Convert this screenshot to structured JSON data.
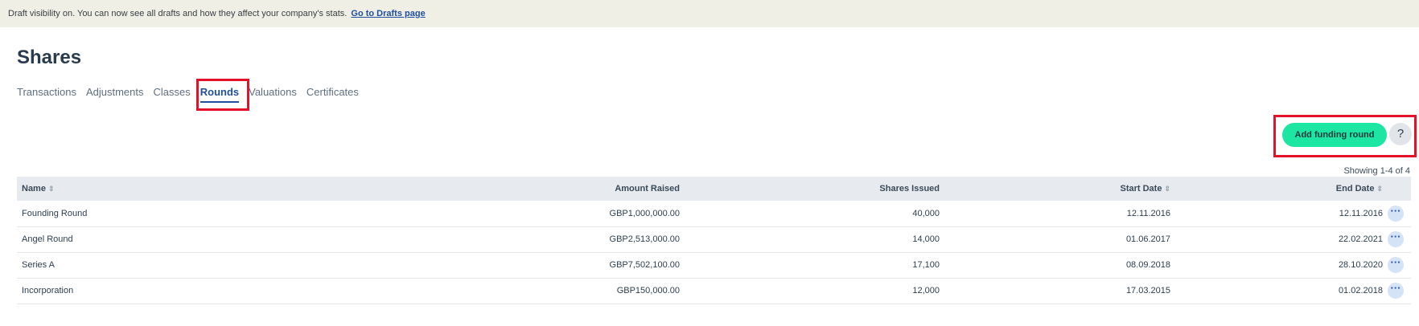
{
  "banner": {
    "text": "Draft visibility on. You can now see all drafts and how they affect your company's stats.",
    "link": "Go to Drafts page"
  },
  "page": {
    "title": "Shares"
  },
  "tabs": [
    {
      "label": "Transactions"
    },
    {
      "label": "Adjustments"
    },
    {
      "label": "Classes"
    },
    {
      "label": "Rounds",
      "active": true
    },
    {
      "label": "Valuations"
    },
    {
      "label": "Certificates"
    }
  ],
  "actions": {
    "add_label": "Add funding round",
    "help_label": "?"
  },
  "table": {
    "showing": "Showing 1-4 of 4",
    "columns": {
      "name": "Name",
      "amount": "Amount Raised",
      "shares": "Shares Issued",
      "start": "Start Date",
      "end": "End Date"
    },
    "sort_icon": "⇕",
    "more_icon": "···",
    "rows": [
      {
        "name": "Founding Round",
        "amount": "GBP1,000,000.00",
        "shares": "40,000",
        "start": "12.11.2016",
        "end": "12.11.2016"
      },
      {
        "name": "Angel Round",
        "amount": "GBP2,513,000.00",
        "shares": "14,000",
        "start": "01.06.2017",
        "end": "22.02.2021"
      },
      {
        "name": "Series A",
        "amount": "GBP7,502,100.00",
        "shares": "17,100",
        "start": "08.09.2018",
        "end": "28.10.2020"
      },
      {
        "name": "Incorporation",
        "amount": "GBP150,000.00",
        "shares": "12,000",
        "start": "17.03.2015",
        "end": "01.02.2018"
      }
    ]
  },
  "colors": {
    "accent": "#1de6a3",
    "link": "#1f4fa0",
    "highlight": "#e3122a"
  }
}
